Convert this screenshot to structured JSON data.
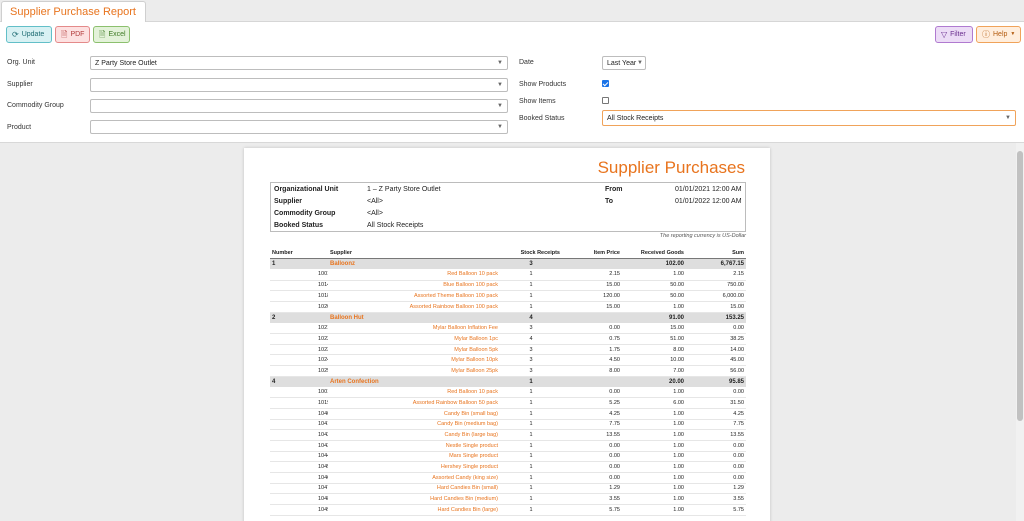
{
  "tab": {
    "title": "Supplier Purchase Report"
  },
  "toolbar": {
    "update": "Update",
    "pdf": "PDF",
    "excel": "Excel",
    "filter": "Filter",
    "help": "Help"
  },
  "filters": {
    "org_unit_label": "Org. Unit",
    "org_unit_value": "Z Party Store Outlet",
    "supplier_label": "Supplier",
    "supplier_value": "",
    "commodity_group_label": "Commodity Group",
    "commodity_group_value": "",
    "product_label": "Product",
    "product_value": "",
    "date_label": "Date",
    "date_value": "Last Year",
    "show_products_label": "Show Products",
    "show_products_checked": true,
    "show_items_label": "Show Items",
    "show_items_checked": false,
    "booked_status_label": "Booked Status",
    "booked_status_value": "All Stock Receipts"
  },
  "report": {
    "title": "Supplier Purchases",
    "info": {
      "org_unit_key": "Organizational Unit",
      "org_unit_val": "1 – Z Party Store Outlet",
      "supplier_key": "Supplier",
      "supplier_val": "<All>",
      "commodity_key": "Commodity Group",
      "commodity_val": "<All>",
      "booked_key": "Booked Status",
      "booked_val": "All Stock Receipts",
      "from_key": "From",
      "from_val": "01/01/2021 12:00 AM",
      "to_key": "To",
      "to_val": "01/01/2022 12:00 AM"
    },
    "currency_note": "The reporting currency is US-Dollar",
    "columns": {
      "number": "Number",
      "supplier": "Supplier",
      "stock_receipts": "Stock Receipts",
      "item_price": "Item Price",
      "received_goods": "Received Goods",
      "sum": "Sum"
    },
    "groups": [
      {
        "number": "1",
        "name": "Balloonz",
        "receipts": "3",
        "received": "102.00",
        "sum": "6,767.15",
        "items": [
          {
            "number": "1001",
            "name": "Red Balloon 10 pack",
            "receipts": "1",
            "price": "2.15",
            "received": "1.00",
            "sum": "2.15"
          },
          {
            "number": "1014",
            "name": "Blue Balloon 100 pack",
            "receipts": "1",
            "price": "15.00",
            "received": "50.00",
            "sum": "750.00"
          },
          {
            "number": "1018",
            "name": "Assorted Theme Balloon 100 pack",
            "receipts": "1",
            "price": "120.00",
            "received": "50.00",
            "sum": "6,000.00"
          },
          {
            "number": "1020",
            "name": "Assorted Rainbow Balloon 100 pack",
            "receipts": "1",
            "price": "15.00",
            "received": "1.00",
            "sum": "15.00"
          }
        ]
      },
      {
        "number": "2",
        "name": "Balloon Hut",
        "receipts": "4",
        "received": "91.00",
        "sum": "153.25",
        "items": [
          {
            "number": "1021",
            "name": "Mylar Balloon Inflation Fee",
            "receipts": "3",
            "price": "0.00",
            "received": "15.00",
            "sum": "0.00"
          },
          {
            "number": "1022",
            "name": "Mylar Balloon 1pc",
            "receipts": "4",
            "price": "0.75",
            "received": "51.00",
            "sum": "38.25"
          },
          {
            "number": "1023",
            "name": "Mylar Balloon 5pk",
            "receipts": "3",
            "price": "1.75",
            "received": "8.00",
            "sum": "14.00"
          },
          {
            "number": "1024",
            "name": "Mylar Balloon 10pk",
            "receipts": "3",
            "price": "4.50",
            "received": "10.00",
            "sum": "45.00"
          },
          {
            "number": "1025",
            "name": "Mylar Balloon 25pk",
            "receipts": "3",
            "price": "8.00",
            "received": "7.00",
            "sum": "56.00"
          }
        ]
      },
      {
        "number": "4",
        "name": "Arten Confection",
        "receipts": "1",
        "received": "20.00",
        "sum": "95.85",
        "items": [
          {
            "number": "1001",
            "name": "Red Balloon 10 pack",
            "receipts": "1",
            "price": "0.00",
            "received": "1.00",
            "sum": "0.00"
          },
          {
            "number": "1019",
            "name": "Assorted Rainbow Balloon 50 pack",
            "receipts": "1",
            "price": "5.25",
            "received": "6.00",
            "sum": "31.50"
          },
          {
            "number": "1040",
            "name": "Candy Bin (small bag)",
            "receipts": "1",
            "price": "4.25",
            "received": "1.00",
            "sum": "4.25"
          },
          {
            "number": "1041",
            "name": "Candy Bin (medium bag)",
            "receipts": "1",
            "price": "7.75",
            "received": "1.00",
            "sum": "7.75"
          },
          {
            "number": "1042",
            "name": "Candy Bin (large bag)",
            "receipts": "1",
            "price": "13.55",
            "received": "1.00",
            "sum": "13.55"
          },
          {
            "number": "1043",
            "name": "Nestle Single product",
            "receipts": "1",
            "price": "0.00",
            "received": "1.00",
            "sum": "0.00"
          },
          {
            "number": "1044",
            "name": "Mars Single product",
            "receipts": "1",
            "price": "0.00",
            "received": "1.00",
            "sum": "0.00"
          },
          {
            "number": "1045",
            "name": "Hershey Single product",
            "receipts": "1",
            "price": "0.00",
            "received": "1.00",
            "sum": "0.00"
          },
          {
            "number": "1046",
            "name": "Assorted Candy (king size)",
            "receipts": "1",
            "price": "0.00",
            "received": "1.00",
            "sum": "0.00"
          },
          {
            "number": "1047",
            "name": "Hard Candies Bin (small)",
            "receipts": "1",
            "price": "1.29",
            "received": "1.00",
            "sum": "1.29"
          },
          {
            "number": "1048",
            "name": "Hard Candies Bin (medium)",
            "receipts": "1",
            "price": "3.55",
            "received": "1.00",
            "sum": "3.55"
          },
          {
            "number": "1049",
            "name": "Hard Candies Bin (large)",
            "receipts": "1",
            "price": "5.75",
            "received": "1.00",
            "sum": "5.75"
          }
        ]
      }
    ]
  }
}
